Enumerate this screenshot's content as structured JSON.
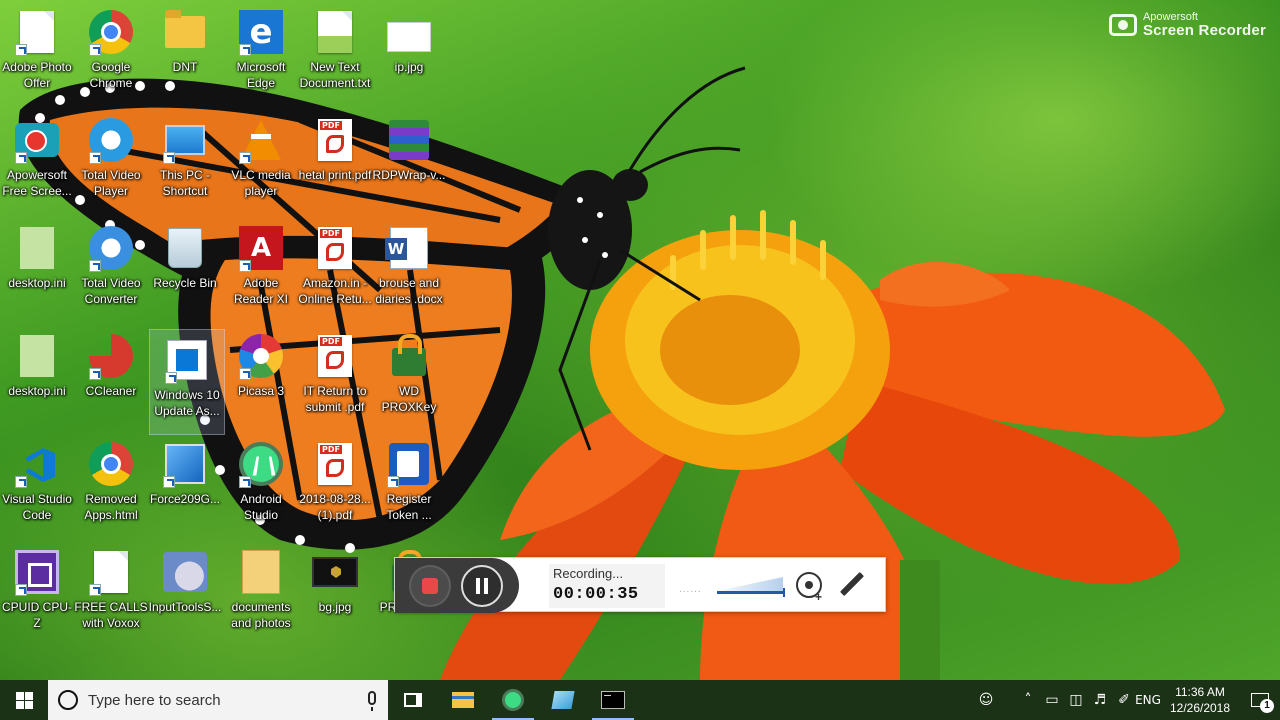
{
  "watermark": {
    "small": "Apowersoft",
    "big": "Screen Recorder"
  },
  "desktop_icons": [
    {
      "label": "Adobe Photo Offer",
      "icon": "blank-document-icon"
    },
    {
      "label": "Google Chrome",
      "icon": "chrome-icon"
    },
    {
      "label": "DNT",
      "icon": "folder-icon"
    },
    {
      "label": "Microsoft Edge",
      "icon": "edge-icon"
    },
    {
      "label": "New Text Document.txt",
      "icon": "text-file-icon"
    },
    {
      "label": "ip.jpg",
      "icon": "image-file-icon"
    },
    {
      "label": "Apowersoft Free Scree...",
      "icon": "apowersoft-recorder-icon"
    },
    {
      "label": "Total Video Player",
      "icon": "video-player-icon"
    },
    {
      "label": "This PC - Shortcut",
      "icon": "this-pc-icon"
    },
    {
      "label": "VLC media player",
      "icon": "vlc-icon"
    },
    {
      "label": "hetal print.pdf",
      "icon": "pdf-icon"
    },
    {
      "label": "RDPWrap-v...",
      "icon": "winrar-archive-icon"
    },
    {
      "label": "desktop.ini",
      "icon": "settings-file-icon"
    },
    {
      "label": "Total Video Converter",
      "icon": "video-converter-icon"
    },
    {
      "label": "Recycle Bin",
      "icon": "recycle-bin-icon"
    },
    {
      "label": "Adobe Reader XI",
      "icon": "adobe-reader-icon"
    },
    {
      "label": "Amazon.in - Online Retu...",
      "icon": "pdf-icon"
    },
    {
      "label": "brouse and diaries .docx",
      "icon": "word-document-icon"
    },
    {
      "label": "desktop.ini",
      "icon": "settings-file-icon"
    },
    {
      "label": "CCleaner",
      "icon": "ccleaner-icon"
    },
    {
      "label": "Windows 10 Update As...",
      "icon": "windows-update-icon"
    },
    {
      "label": "Picasa 3",
      "icon": "picasa-icon"
    },
    {
      "label": "IT Return to submit .pdf",
      "icon": "pdf-icon"
    },
    {
      "label": "WD PROXKey",
      "icon": "lock-icon"
    },
    {
      "label": "Visual Studio Code",
      "icon": "vscode-icon"
    },
    {
      "label": "Removed Apps.html",
      "icon": "chrome-icon"
    },
    {
      "label": "Force209G...",
      "icon": "installer-icon"
    },
    {
      "label": "Android Studio",
      "icon": "android-studio-icon"
    },
    {
      "label": "2018-08-28... (1).pdf",
      "icon": "pdf-icon"
    },
    {
      "label": "Register Token ...",
      "icon": "register-clipboard-icon"
    },
    {
      "label": "CPUID CPU-Z",
      "icon": "cpuz-icon"
    },
    {
      "label": "FREE CALLS with Voxox",
      "icon": "blank-document-icon"
    },
    {
      "label": "InputToolsS...",
      "icon": "disc-installer-icon"
    },
    {
      "label": "documents and photos",
      "icon": "document-folder-icon"
    },
    {
      "label": "bg.jpg",
      "icon": "image-file-icon"
    },
    {
      "label": "PROXKe...",
      "icon": "lock-icon"
    }
  ],
  "recorder": {
    "status_label": "Recording...",
    "elapsed": "00:00:35",
    "dots": "......",
    "stop_icon": "stop-icon",
    "pause_icon": "pause-icon",
    "webcam_icon": "webcam-add-icon",
    "pen_icon": "pen-icon",
    "stop_color": "#e84848"
  },
  "taskbar": {
    "search_placeholder": "Type here to search",
    "pinned": [
      "task-view-icon",
      "file-explorer-icon",
      "android-studio-icon",
      "app-icon",
      "command-prompt-icon"
    ],
    "tray": {
      "language": "ENG",
      "time": "11:36 AM",
      "date": "12/26/2018",
      "notification_count": "1"
    }
  }
}
